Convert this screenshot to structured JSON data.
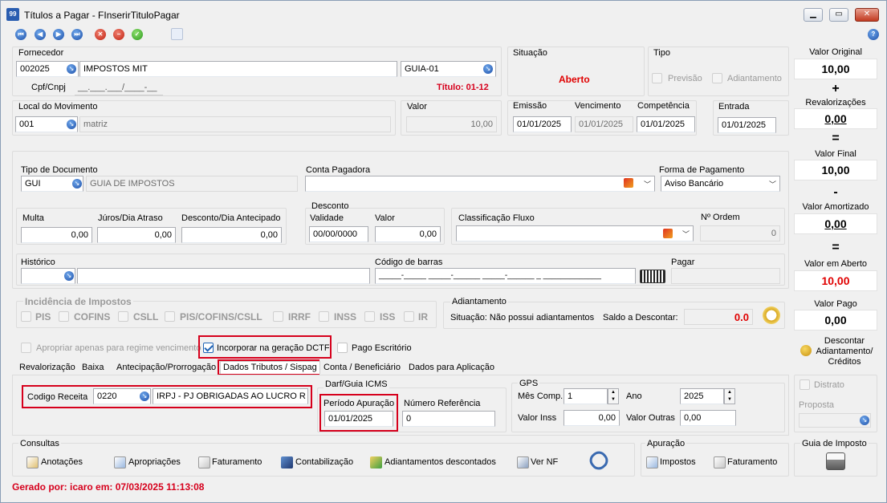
{
  "window": {
    "title": "Títulos a Pagar - FInserirTituloPagar",
    "app_icon": "99"
  },
  "fornecedor": {
    "label": "Fornecedor",
    "code": "002025",
    "name": "IMPOSTOS MIT",
    "guia": "GUIA-01",
    "cpf_label": "Cpf/Cnpj",
    "cpf_mask": "__.___.___/____-__",
    "titulo": "Título: 01-12"
  },
  "situacao": {
    "label": "Situação",
    "value": "Aberto"
  },
  "tipo": {
    "label": "Tipo",
    "previsao": "Previsão",
    "adiantamento": "Adiantamento"
  },
  "local": {
    "label": "Local do Movimento",
    "code": "001",
    "name": "matriz"
  },
  "valor": {
    "label": "Valor",
    "value": "10,00"
  },
  "datas": {
    "emissao_label": "Emissão",
    "emissao": "01/01/2025",
    "vencimento_label": "Vencimento",
    "vencimento": "01/01/2025",
    "competencia_label": "Competência",
    "competencia": "01/01/2025",
    "entrada_label": "Entrada",
    "entrada": "01/01/2025"
  },
  "documento": {
    "tipo_label": "Tipo de Documento",
    "tipo_code": "GUI",
    "tipo_name": "GUIA DE IMPOSTOS",
    "conta_label": "Conta Pagadora",
    "forma_label": "Forma de Pagamento",
    "forma_value": "Aviso Bancário"
  },
  "valores": {
    "multa_label": "Multa",
    "multa": "0,00",
    "juros_label": "Júros/Dia Atraso",
    "juros": "0,00",
    "desconto_dia_label": "Desconto/Dia Antecipado",
    "desconto_dia": "0,00",
    "desconto_label": "Desconto",
    "validade_label": "Validade",
    "validade": "00/00/0000",
    "valor_label": "Valor",
    "valor": "0,00",
    "classificacao_label": "Classificação Fluxo",
    "ordem_label": "Nº Ordem",
    "ordem": "0"
  },
  "historico": {
    "label": "Histórico",
    "barcode_label": "Código de barras",
    "barcode_mask": "_____-_____ _____-______ _____-______ _ _____________",
    "pagar_label": "Pagar"
  },
  "impostos": {
    "label": "Incidência de Impostos",
    "items": [
      "PIS",
      "COFINS",
      "CSLL",
      "PIS/COFINS/CSLL",
      "IRRF",
      "INSS",
      "ISS",
      "IR"
    ]
  },
  "adiantamento": {
    "label": "Adiantamento",
    "situacao": "Situação: Não possui adiantamentos",
    "saldo_label": "Saldo a Descontar:",
    "saldo": "0.0"
  },
  "opcoes": {
    "apropriar": "Apropriar apenas para regime vencimento",
    "incorporar": "Incorporar na geração DCTF",
    "pago_escritorio": "Pago Escritório"
  },
  "tabs": [
    "Revalorização",
    "Baixa",
    "Antecipação/Prorrogação",
    "Dados Tributos / Sispag",
    "Conta / Beneficiário",
    "Dados para Aplicação"
  ],
  "tributos": {
    "codigo_label": "Codigo Receita",
    "codigo": "0220",
    "codigo_desc": "IRPJ - PJ OBRIGADAS AO LUCRO R",
    "darf_label": "Darf/Guia ICMS",
    "periodo_label": "Período Apuração",
    "periodo": "01/01/2025",
    "referencia_label": "Número Referência",
    "referencia": "0"
  },
  "gps": {
    "label": "GPS",
    "mes_label": "Mês Comp.",
    "mes": "1",
    "ano_label": "Ano",
    "ano": "2025",
    "inss_label": "Valor Inss",
    "inss": "0,00",
    "outras_label": "Valor Outras",
    "outras": "0,00"
  },
  "resumo": {
    "original_label": "Valor Original",
    "original": "10,00",
    "revalorizacoes_label": "Revalorizações",
    "revalorizacoes": "0,00",
    "final_label": "Valor Final",
    "final": "10,00",
    "amortizado_label": "Valor Amortizado",
    "amortizado": "0,00",
    "aberto_label": "Valor em Aberto",
    "aberto": "10,00",
    "pago_label": "Valor Pago",
    "pago": "0,00",
    "descontar_label": "Descontar Adiantamento/ Créditos",
    "plus": "+",
    "eq1": "=",
    "minus": "-",
    "eq2": "=",
    "eq3": "="
  },
  "distrato": {
    "label": "Distrato",
    "proposta_label": "Proposta"
  },
  "consultas": {
    "label": "Consultas",
    "items": [
      "Anotações",
      "Apropriações",
      "Faturamento",
      "Contabilização",
      "Adiantamentos descontados",
      "Ver NF"
    ]
  },
  "apuracao": {
    "label": "Apuração",
    "impostos": "Impostos",
    "faturamento": "Faturamento"
  },
  "guia_imposto": {
    "label": "Guia de Imposto"
  },
  "footer": {
    "gerado": "Gerado por: icaro em: 07/03/2025 11:13:08"
  },
  "colors": {
    "accent_red": "#d6001c",
    "situacao_red": "#e00000",
    "highlight_box": "#d6001c"
  }
}
